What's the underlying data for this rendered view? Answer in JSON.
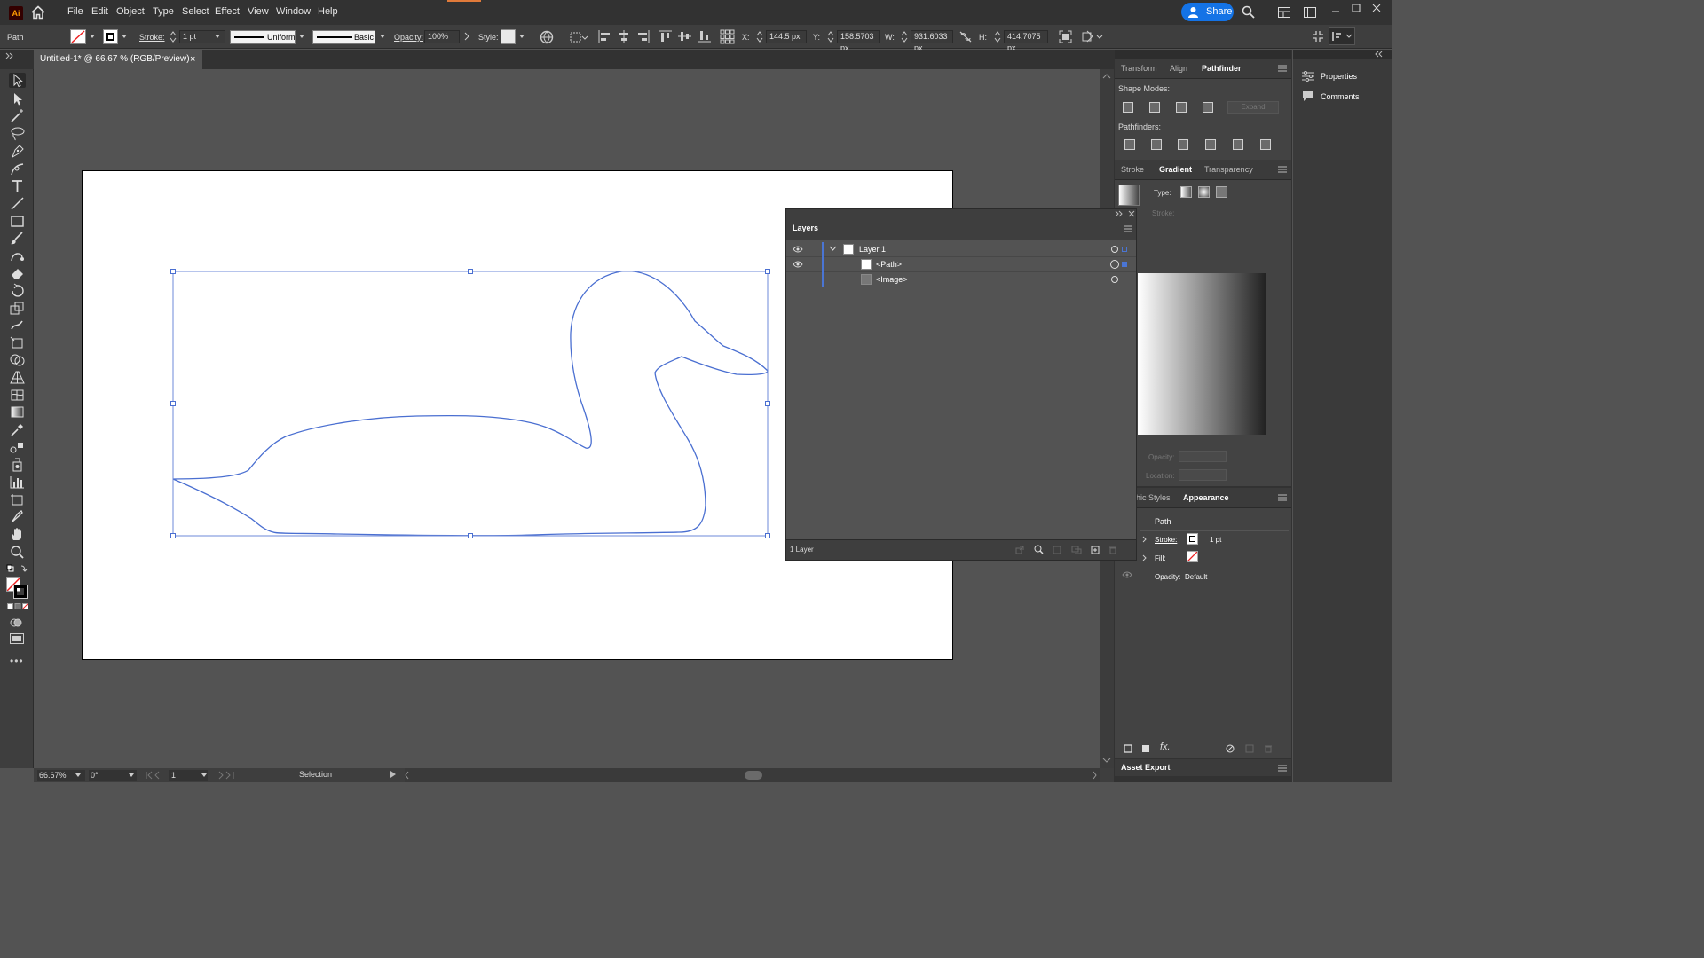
{
  "app": {
    "logo": "Ai",
    "menus": [
      "File",
      "Edit",
      "Object",
      "Type",
      "Select",
      "Effect",
      "View",
      "Window",
      "Help"
    ],
    "share_label": "Share"
  },
  "control_bar": {
    "selection_type": "Path",
    "stroke_label": "Stroke:",
    "stroke_weight": "1 pt",
    "uniform_label": "Uniform",
    "basic_label": "Basic",
    "opacity_label": "Opacity:",
    "opacity_value": "100%",
    "style_label": "Style:",
    "x_label": "X:",
    "x_value": "144.5 px",
    "y_label": "Y:",
    "y_value": "158.5703 px",
    "w_label": "W:",
    "w_value": "931.6033 px",
    "h_label": "H:",
    "h_value": "414.7075 px"
  },
  "document": {
    "tab_title": "Untitled-1* @ 66.67 % (RGB/Preview)",
    "close_glyph": "×"
  },
  "status_bar": {
    "zoom": "66.67%",
    "rotation": "0°",
    "artboard_number": "1",
    "tool_name": "Selection"
  },
  "panels": {
    "top_tabs": [
      "Transform",
      "Align",
      "Pathfinder"
    ],
    "shape_modes_label": "Shape Modes:",
    "expand_label": "Expand",
    "pathfinders_label": "Pathfinders:",
    "mid_tabs": [
      "Stroke",
      "Gradient",
      "Transparency"
    ],
    "gradient": {
      "type_label": "Type:",
      "stroke_label": "Stroke:",
      "opacity_label": "Opacity:",
      "location_label": "Location:"
    },
    "bottom_tabs": [
      "hic Styles",
      "Appearance"
    ],
    "appearance": {
      "title": "Path",
      "stroke_label": "Stroke:",
      "stroke_value": "1 pt",
      "fill_label": "Fill:",
      "opacity_label": "Opacity:",
      "opacity_value": "Default"
    },
    "asset_export": "Asset Export"
  },
  "right_side": {
    "properties": "Properties",
    "comments": "Comments"
  },
  "layers": {
    "title": "Layers",
    "rows": [
      {
        "name": "Layer 1"
      },
      {
        "name": "<Path>"
      },
      {
        "name": "<Image>"
      }
    ],
    "footer": "1 Layer"
  },
  "colors": {
    "selection": "#4a6fd1",
    "accent": "#1473e6"
  }
}
